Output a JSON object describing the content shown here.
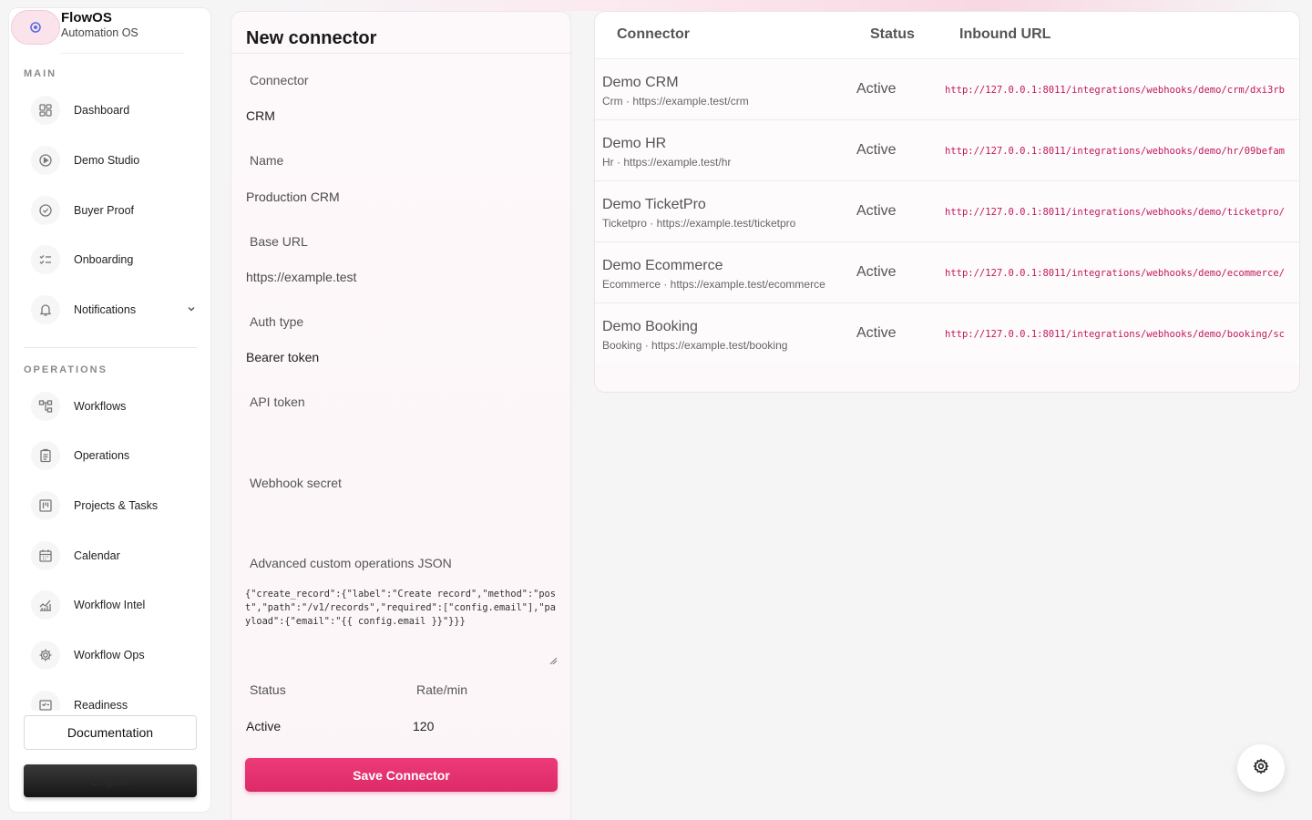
{
  "brand": {
    "name": "FlowOS",
    "subtitle": "Automation OS"
  },
  "sidebar": {
    "main_label": "MAIN",
    "main_items": [
      {
        "label": "Dashboard",
        "icon": "dashboard-icon"
      },
      {
        "label": "Demo Studio",
        "icon": "play-circle-icon"
      },
      {
        "label": "Buyer Proof",
        "icon": "check-badge-icon"
      },
      {
        "label": "Onboarding",
        "icon": "checklist-icon"
      },
      {
        "label": "Notifications",
        "icon": "bell-icon"
      }
    ],
    "operations_label": "OPERATIONS",
    "operations_items": [
      {
        "label": "Workflows",
        "icon": "workflow-icon"
      },
      {
        "label": "Operations",
        "icon": "clipboard-icon"
      },
      {
        "label": "Projects & Tasks",
        "icon": "kanban-icon"
      },
      {
        "label": "Calendar",
        "icon": "calendar-icon"
      },
      {
        "label": "Workflow Intel",
        "icon": "chart-icon"
      },
      {
        "label": "Workflow Ops",
        "icon": "gear-icon"
      },
      {
        "label": "Readiness",
        "icon": "readiness-icon"
      }
    ],
    "documentation_label": "Documentation",
    "logout_label": "Logout"
  },
  "form": {
    "title": "New connector",
    "connector_label": "Connector",
    "connector_value": "CRM",
    "name_label": "Name",
    "name_value": "Production CRM",
    "base_url_label": "Base URL",
    "base_url_value": "https://example.test",
    "auth_type_label": "Auth type",
    "auth_type_value": "Bearer token",
    "api_token_label": "API token",
    "webhook_secret_label": "Webhook secret",
    "json_label": "Advanced custom operations JSON",
    "json_value": "{\"create_record\":{\"label\":\"Create record\",\"method\":\"post\",\"path\":\"/v1/records\",\"required\":[\"config.email\"],\"payload\":{\"email\":\"{{ config.email }}\"}}}",
    "status_label": "Status",
    "status_value": "Active",
    "rate_label": "Rate/min",
    "rate_value": "120",
    "save_label": "Save Connector"
  },
  "table": {
    "columns": [
      "Connector",
      "Status",
      "Inbound URL"
    ],
    "rows": [
      {
        "name": "Demo CRM",
        "sub": "Crm · https://example.test/crm",
        "status": "Active",
        "url": "http://127.0.0.1:8011/integrations/webhooks/demo/crm/dxi3rb"
      },
      {
        "name": "Demo HR",
        "sub": "Hr · https://example.test/hr",
        "status": "Active",
        "url": "http://127.0.0.1:8011/integrations/webhooks/demo/hr/09befam"
      },
      {
        "name": "Demo TicketPro",
        "sub": "Ticketpro · https://example.test/ticketpro",
        "status": "Active",
        "url": "http://127.0.0.1:8011/integrations/webhooks/demo/ticketpro/"
      },
      {
        "name": "Demo Ecommerce",
        "sub": "Ecommerce · https://example.test/ecommerce",
        "status": "Active",
        "url": "http://127.0.0.1:8011/integrations/webhooks/demo/ecommerce/"
      },
      {
        "name": "Demo Booking",
        "sub": "Booking · https://example.test/booking",
        "status": "Active",
        "url": "http://127.0.0.1:8011/integrations/webhooks/demo/booking/sc"
      }
    ]
  },
  "colors": {
    "accent": "#e3306f",
    "url_text": "#c2185b"
  }
}
